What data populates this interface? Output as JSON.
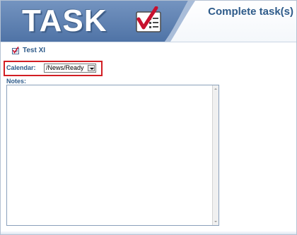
{
  "app": {
    "logo_text": "TASK",
    "page_title": "Complete task(s)"
  },
  "task": {
    "name": "Test XI",
    "icon": "task-checklist-icon"
  },
  "calendar": {
    "label": "Calendar:",
    "selected": "/News/Ready"
  },
  "notes": {
    "label": "Notes:",
    "value": ""
  },
  "colors": {
    "accent": "#2e5b8a",
    "highlight_border": "#d21e24",
    "banner_blue": "#5b7fb0",
    "check_red": "#c8102e"
  }
}
